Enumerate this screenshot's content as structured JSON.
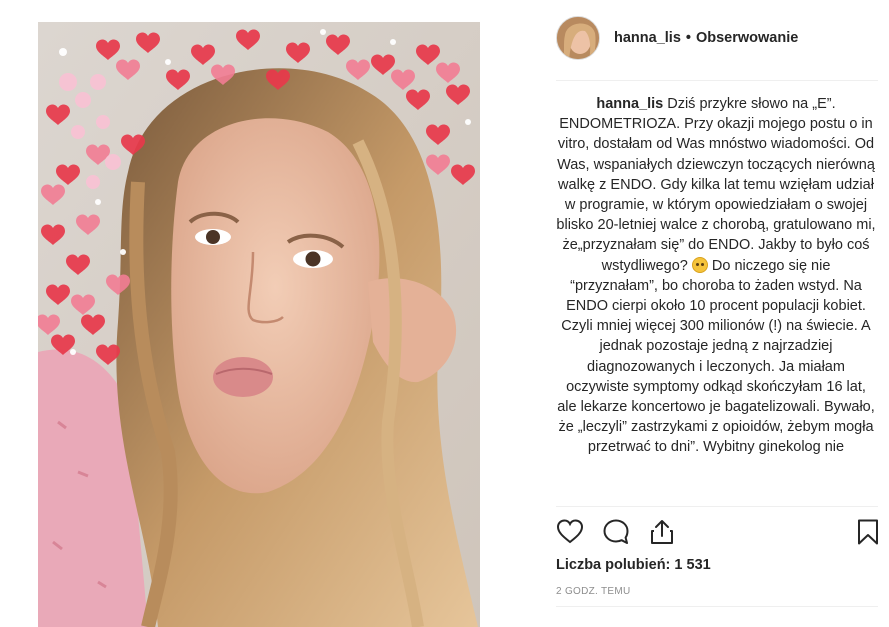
{
  "post": {
    "username": "hanna_lis",
    "separator": "•",
    "follow_label": "Obserwowanie",
    "caption_username": "hanna_lis",
    "caption_part1": "Dziś przykre słowo na „E”. ENDOMETRIOZA. Przy okazji mojego postu o in vitro, dostałam od Was mnóstwo wiadomości. Od Was, wspaniałych dziewczyn toczących nierówną walkę z ENDO. Gdy kilka lat temu wzięłam udział w programie, w którym opowiedziałam o swojej blisko 20-letniej walce z chorobą, gratulowano mi, że„przyznałam się” do ENDO. Jakby to było coś wstydliwego?",
    "caption_emoji": "thinking-face-emoji",
    "caption_part2": "Do niczego się nie “przyznałam”, bo choroba to żaden wstyd. Na ENDO cierpi około 10 procent populacji kobiet. Czyli mniej więcej 300 milionów (!) na świecie. A jednak pozostaje jedną z najrzadziej diagnozowanych i leczonych. Ja miałam oczywiste symptomy odkąd skończyłam 16 lat, ale lekarze koncertowo je bagatelizowali. Bywało, że „leczyli” zastrzykami z opioidów, żebym mogła przetrwać  to dni”. Wybitny ginekolog nie",
    "likes_text": "Liczba polubień: 1 531",
    "time_text": "2 GODZ. TEMU"
  },
  "icons": {
    "like": "heart-outline-icon",
    "comment": "comment-bubble-icon",
    "share": "share-upload-icon",
    "save": "bookmark-icon"
  },
  "colors": {
    "text": "#262626",
    "muted": "#8e8e8e",
    "divider": "#efefef",
    "heart_red": "#e8394b",
    "heart_pink": "#f27d94"
  }
}
